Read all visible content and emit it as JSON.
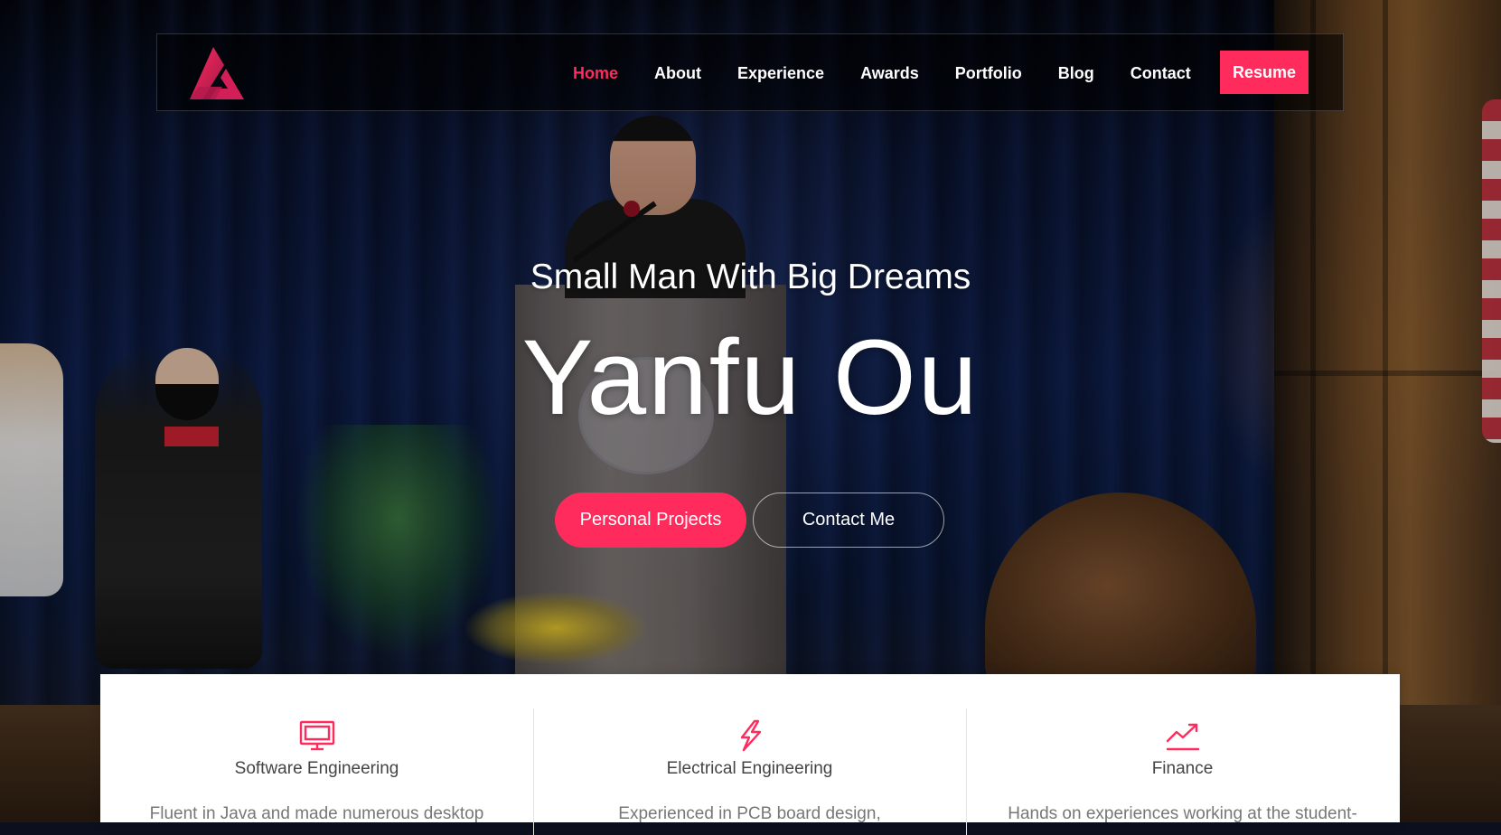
{
  "nav": {
    "logo_icon": "triangle-logo-icon",
    "links": [
      {
        "label": "Home",
        "active": true
      },
      {
        "label": "About",
        "active": false
      },
      {
        "label": "Experience",
        "active": false
      },
      {
        "label": "Awards",
        "active": false
      },
      {
        "label": "Portfolio",
        "active": false
      },
      {
        "label": "Blog",
        "active": false
      },
      {
        "label": "Contact",
        "active": false
      }
    ],
    "resume_label": "Resume"
  },
  "hero": {
    "tagline": "Small Man With Big Dreams",
    "name": "Yanfu Ou",
    "primary_button": "Personal Projects",
    "secondary_button": "Contact Me"
  },
  "services": [
    {
      "icon": "monitor-icon",
      "title": "Software Engineering",
      "description": "Fluent in Java and made numerous desktop"
    },
    {
      "icon": "lightning-icon",
      "title": "Electrical Engineering",
      "description": "Experienced in PCB board design,"
    },
    {
      "icon": "trending-up-icon",
      "title": "Finance",
      "description": "Hands on experiences working at the student-"
    }
  ],
  "colors": {
    "accent": "#ff2b5c",
    "text_dark": "#444444",
    "text_muted": "#777777",
    "white": "#ffffff"
  }
}
